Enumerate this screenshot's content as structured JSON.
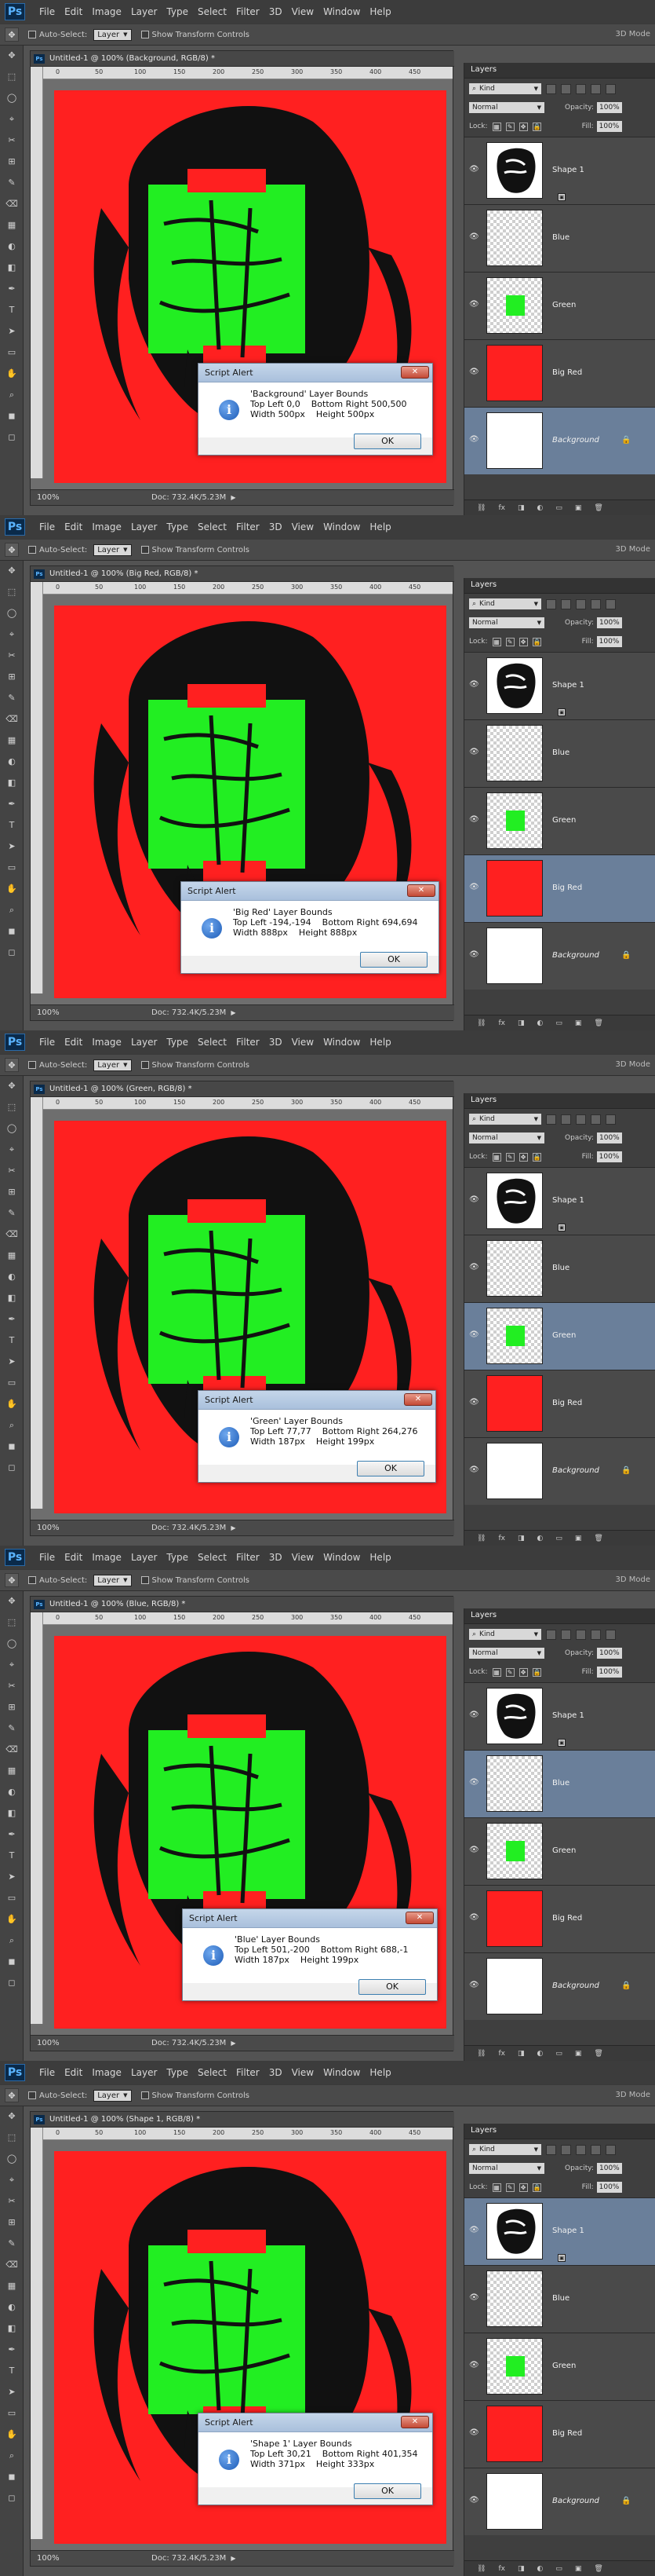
{
  "app": {
    "logo": "Ps",
    "menu": [
      "File",
      "Edit",
      "Image",
      "Layer",
      "Type",
      "Select",
      "Filter",
      "3D",
      "View",
      "Window",
      "Help"
    ],
    "options": {
      "auto_select_label": "Auto-Select:",
      "auto_select_value": "Layer",
      "show_transform_label": "Show Transform Controls",
      "workspace_label": "3D Mode"
    },
    "ruler_ticks": [
      "0",
      "50",
      "100",
      "150",
      "200",
      "250",
      "300",
      "350",
      "400",
      "450"
    ],
    "status": {
      "zoom": "100%",
      "doc": "Doc: 732.4K/5.23M"
    },
    "layers_panel": {
      "tab": "Layers",
      "kind": "Kind",
      "blend": "Normal",
      "opacity_label": "Opacity:",
      "opacity_value": "100%",
      "lock_label": "Lock:",
      "fill_label": "Fill:",
      "fill_value": "100%",
      "bottom_icons": [
        "fx",
        "mask",
        "adjust",
        "group",
        "new",
        "trash"
      ]
    },
    "dialog_title": "Script Alert",
    "ok_label": "OK",
    "canvas_color": "#ff2020",
    "green_color": "#22ee22",
    "selection_color": "#6a7f9a"
  },
  "layers": [
    {
      "name": "Shape 1",
      "thumb": "shape"
    },
    {
      "name": "Blue",
      "thumb": "transparent"
    },
    {
      "name": "Green",
      "thumb": "green"
    },
    {
      "name": "Big Red",
      "thumb": "red"
    },
    {
      "name": "Background",
      "thumb": "white",
      "italic": true,
      "locked": true
    }
  ],
  "shots": [
    {
      "doc_title": "Untitled-1 @ 100% (Background, RGB/8) *",
      "selected_layer": 4,
      "alert": {
        "line1": "'Background' Layer Bounds",
        "line2": "Top Left 0,0    Bottom Right 500,500",
        "line3": "Width 500px    Height 500px"
      }
    },
    {
      "doc_title": "Untitled-1 @ 100% (Big Red, RGB/8) *",
      "selected_layer": 3,
      "alert": {
        "line1": "'Big Red' Layer Bounds",
        "line2": "Top Left -194,-194    Bottom Right 694,694",
        "line3": "Width 888px    Height 888px"
      }
    },
    {
      "doc_title": "Untitled-1 @ 100% (Green, RGB/8) *",
      "selected_layer": 2,
      "alert": {
        "line1": "'Green' Layer Bounds",
        "line2": "Top Left 77,77    Bottom Right 264,276",
        "line3": "Width 187px    Height 199px"
      }
    },
    {
      "doc_title": "Untitled-1 @ 100% (Blue, RGB/8) *",
      "selected_layer": 1,
      "alert": {
        "line1": "'Blue' Layer Bounds",
        "line2": "Top Left 501,-200    Bottom Right 688,-1",
        "line3": "Width 187px    Height 199px"
      }
    },
    {
      "doc_title": "Untitled-1 @ 100% (Shape 1, RGB/8) *",
      "selected_layer": 0,
      "alert": {
        "line1": "'Shape 1' Layer Bounds",
        "line2": "Top Left 30,21    Bottom Right 401,354",
        "line3": "Width 371px    Height 333px"
      }
    }
  ]
}
